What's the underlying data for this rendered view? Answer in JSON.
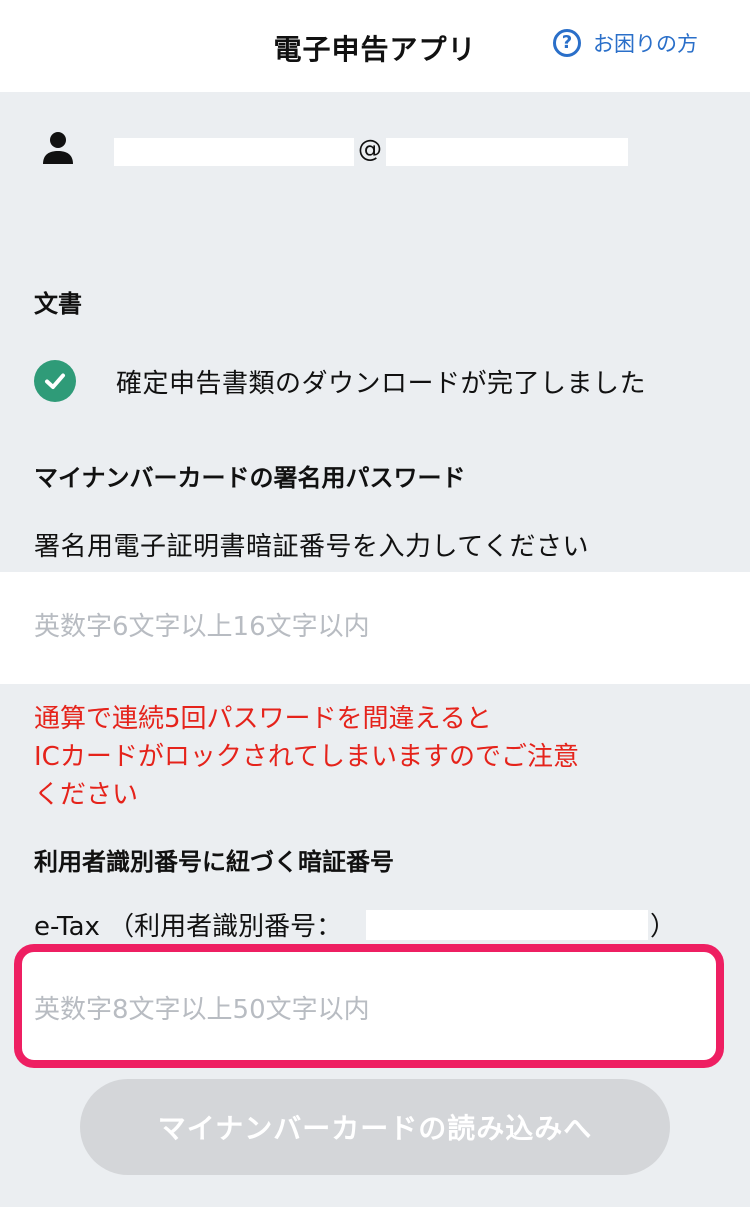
{
  "header": {
    "title": "電子申告アプリ",
    "help_label": "お困りの方",
    "help_icon": "?"
  },
  "account": {
    "at_sign": "@"
  },
  "document": {
    "section_title": "文書",
    "status_text": "確定申告書類のダウンロードが完了しました"
  },
  "signature": {
    "section_title": "マイナンバーカードの署名用パスワード",
    "description": "署名用電子証明書暗証番号を入力してください",
    "placeholder": "英数字6文字以上16文字以内",
    "warning_line1": "通算で連続5回パスワードを間違えると",
    "warning_line2": "ICカードがロックされてしまいますのでご注意",
    "warning_line3": "ください"
  },
  "user_pin": {
    "section_title": "利用者識別番号に紐づく暗証番号",
    "etax_label": "e-Tax （利用者識別番号：",
    "etax_close": "）",
    "placeholder": "英数字8文字以上50文字以内"
  },
  "next_button": {
    "label": "マイナンバーカードの読み込みへ"
  },
  "colors": {
    "accent_blue": "#2a6fc9",
    "success_green": "#2f9b78",
    "warning_red": "#e5231b",
    "highlight_pink": "#ee1f62",
    "disabled_button": "#d4d6d9"
  },
  "icons": {
    "help": "question-circle-icon",
    "user": "person-icon",
    "status": "check-circle-icon"
  }
}
